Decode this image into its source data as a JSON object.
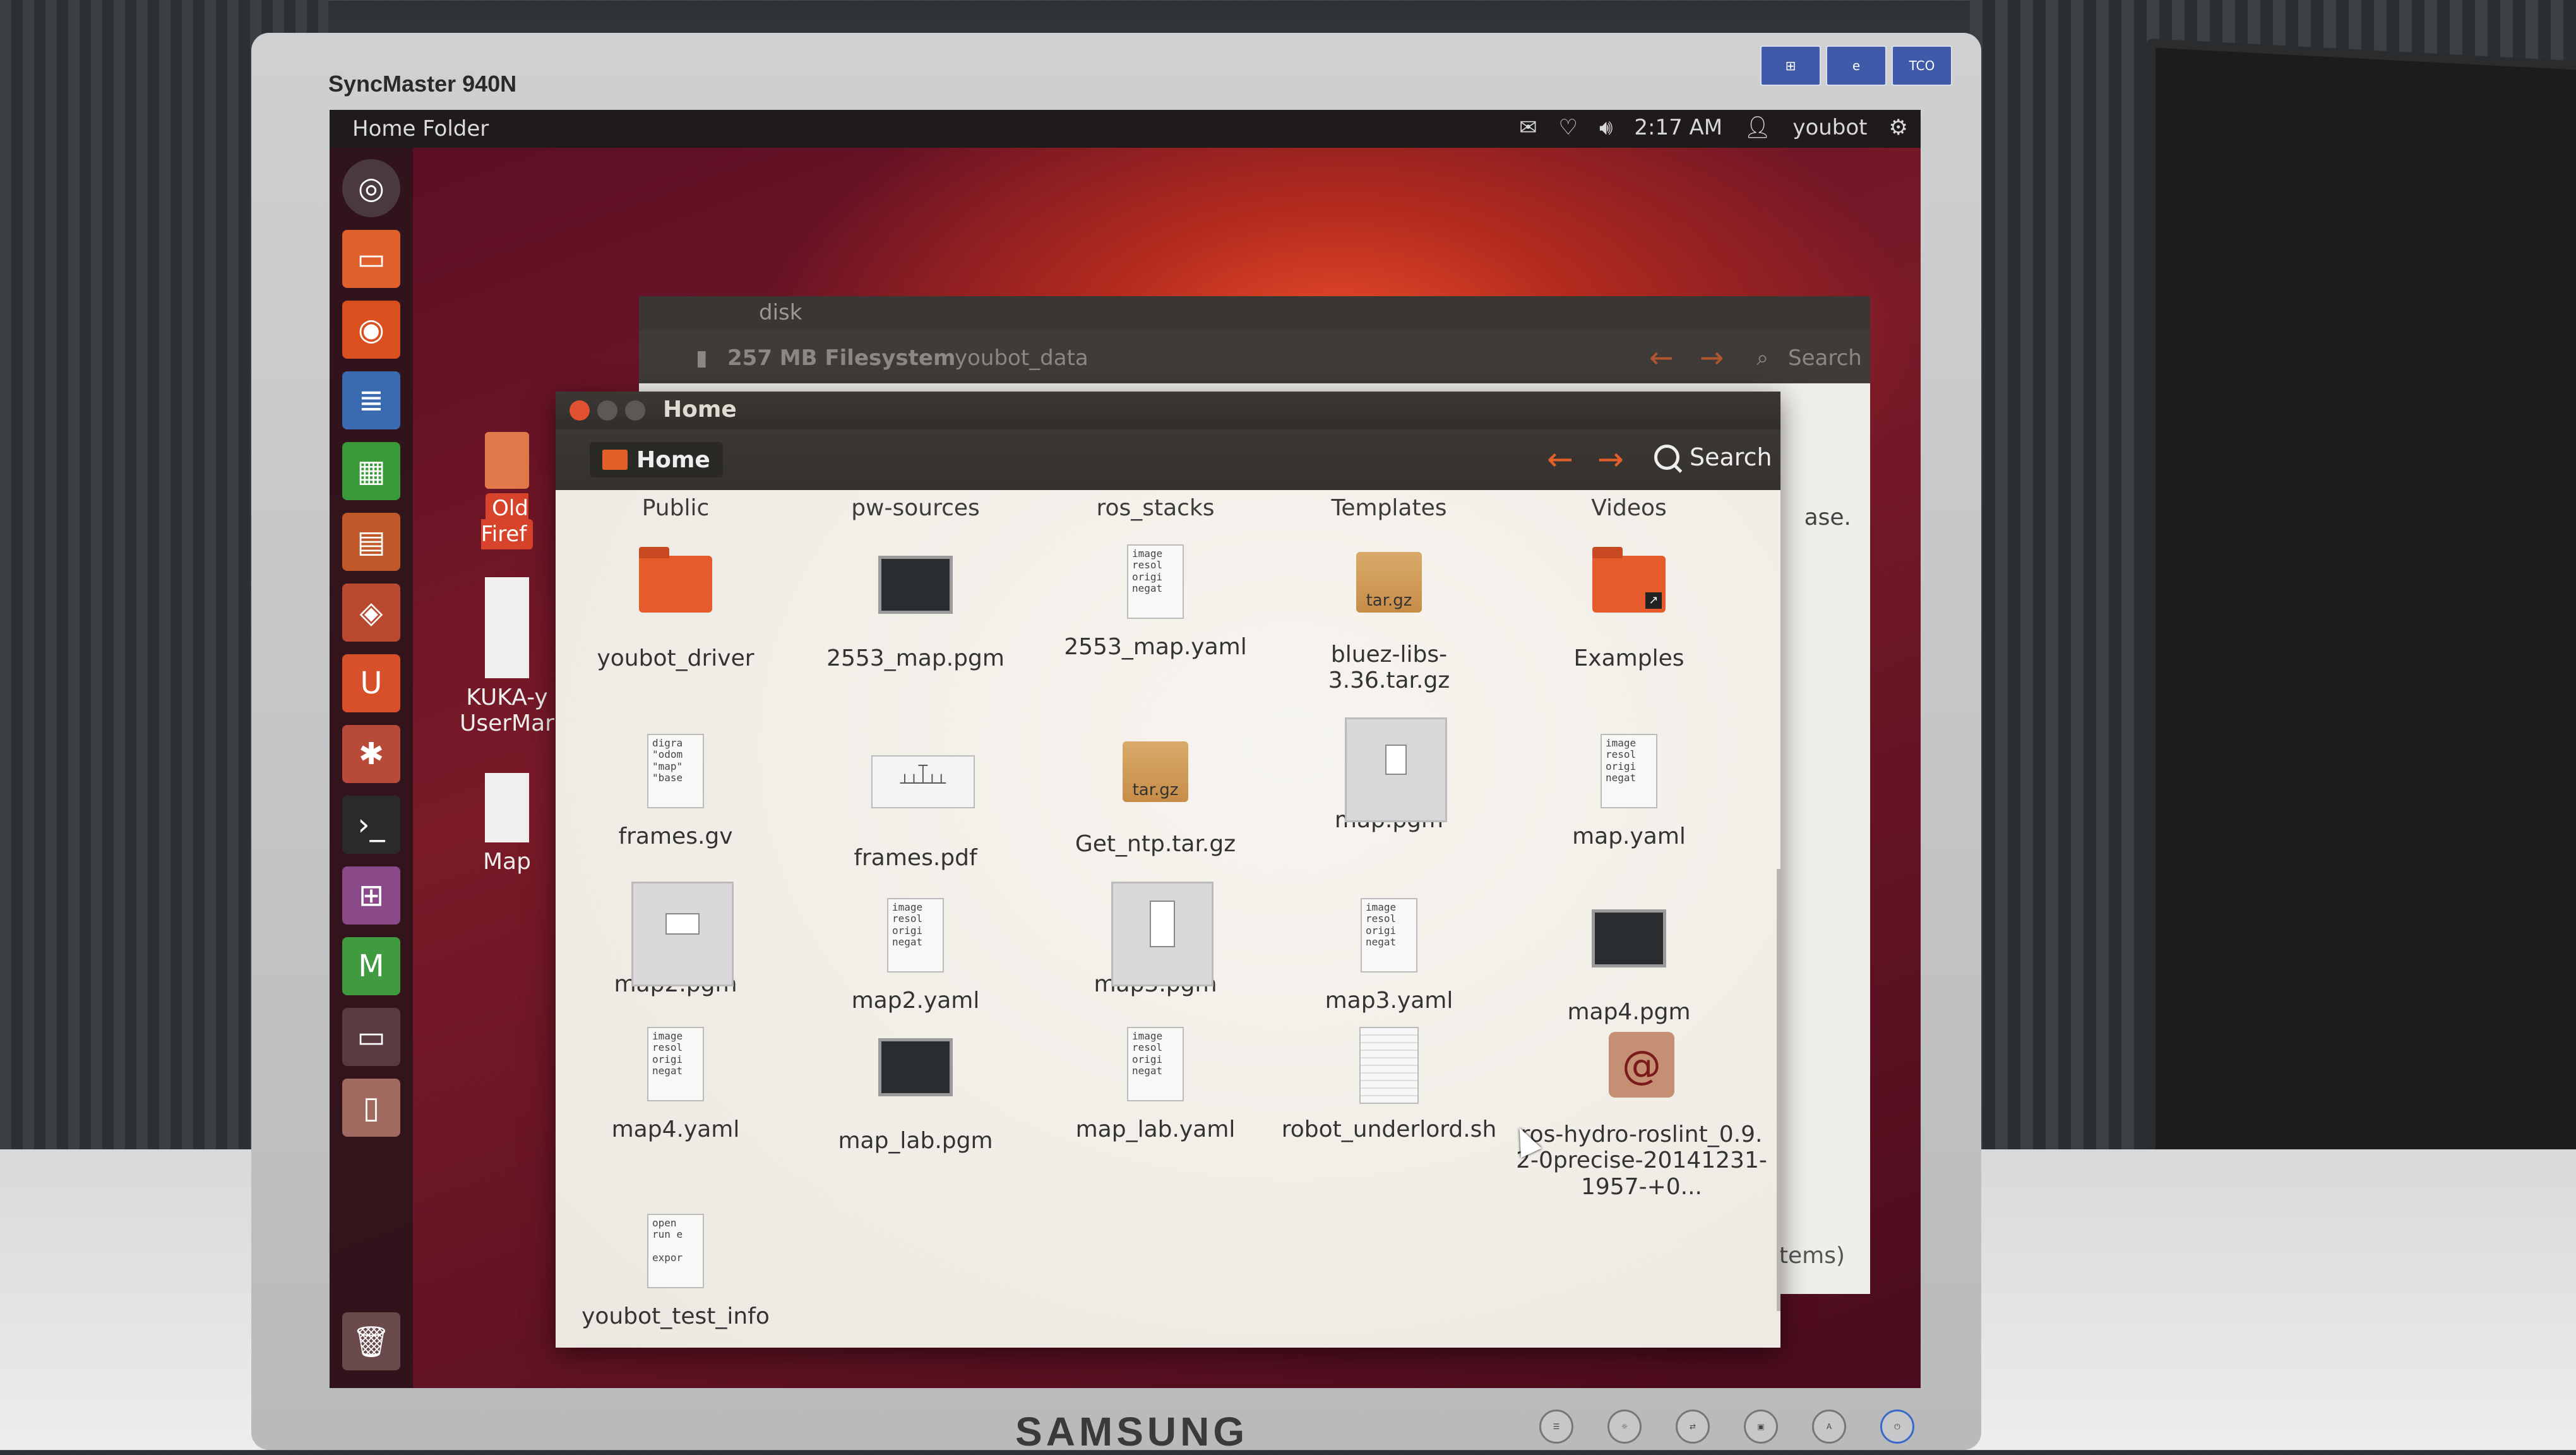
{
  "monitor": {
    "model": "SyncMaster 940N",
    "brand": "SAMSUNG"
  },
  "topbar": {
    "title": "Home Folder",
    "clock": "2:17 AM",
    "user": "youbot"
  },
  "desktop_icons": [
    {
      "label": "Old Firef"
    },
    {
      "label": "KUKA-y UserMar"
    },
    {
      "label": "Map"
    }
  ],
  "back_window": {
    "title": "disk",
    "location": "257 MB Filesystem",
    "location2": "youbot_data",
    "search_label": "Search",
    "partial_text": "ase.",
    "status": "items)"
  },
  "window": {
    "title": "Home",
    "breadcrumb": "Home",
    "search_label": "Search",
    "column_headers": [
      "Public",
      "pw-sources",
      "ros_stacks",
      "Templates",
      "Videos"
    ],
    "files": [
      {
        "name": "youbot_driver",
        "type": "folder"
      },
      {
        "name": "2553_map.pgm",
        "type": "dark-image"
      },
      {
        "name": "2553_map.yaml",
        "type": "text",
        "preview": "image\nresol\norigi\nnegat"
      },
      {
        "name": "bluez-libs-3.36.tar.gz",
        "type": "archive",
        "badge": "tar.gz"
      },
      {
        "name": "Examples",
        "type": "folder-link"
      },
      {
        "name": "frames.gv",
        "type": "text",
        "preview": "digra\n\"odom\n\"map\"\n\"base"
      },
      {
        "name": "frames.pdf",
        "type": "pdf"
      },
      {
        "name": "Get_ntp.tar.gz",
        "type": "archive",
        "badge": "tar.gz"
      },
      {
        "name": "map.pgm",
        "type": "light-image"
      },
      {
        "name": "map.yaml",
        "type": "text",
        "preview": "image\nresol\norigi\nnegat"
      },
      {
        "name": "map2.pgm",
        "type": "light-image"
      },
      {
        "name": "map2.yaml",
        "type": "text",
        "preview": "image\nresol\norigi\nnegat"
      },
      {
        "name": "map3.pgm",
        "type": "light-image"
      },
      {
        "name": "map3.yaml",
        "type": "text",
        "preview": "image\nresol\norigi\nnegat"
      },
      {
        "name": "map4.pgm",
        "type": "dark-image"
      },
      {
        "name": "map4.yaml",
        "type": "text",
        "preview": "image\nresol\norigi\nnegat"
      },
      {
        "name": "map_lab.pgm",
        "type": "dark-image"
      },
      {
        "name": "map_lab.yaml",
        "type": "text",
        "preview": "image\nresol\norigi\nnegat"
      },
      {
        "name": "robot_underlord.sh",
        "type": "script"
      },
      {
        "name": "ros-hydro-roslint_0.9.2-0precise-20141231-1957-+0...",
        "type": "debian"
      },
      {
        "name": "youbot_test_info",
        "type": "text",
        "preview": "open\nrun e\n\nexpor"
      }
    ]
  }
}
